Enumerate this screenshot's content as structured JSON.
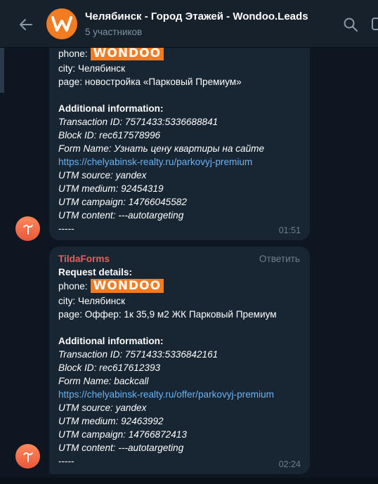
{
  "header": {
    "title": "Челябинск - Город Этажей - Wondoo.Leads",
    "subtitle": "5 участников",
    "avatar_letter": "W"
  },
  "brand_tag": "WONDOO",
  "messages": [
    {
      "phone_label": "phone:",
      "city": "city: Челябинск",
      "page": "page: новостройка «Парковый Премиум»",
      "additional_heading": "Additional information:",
      "transaction": "Transaction ID: 7571433:5336688841",
      "block": "Block ID: rec617578996",
      "form": "Form Name: Узнать цену квартиры на сайте",
      "url": "https://chelyabinsk-realty.ru/parkovyj-premium",
      "utm_source": "UTM source: yandex",
      "utm_medium": "UTM medium: 92454319",
      "utm_campaign": "UTM campaign: 14766045582",
      "utm_content": "UTM content: ---autotargeting",
      "separator": "-----",
      "time": "01:51"
    },
    {
      "sender": "TildaForms",
      "reply_label": "Ответить",
      "request_heading": "Request details:",
      "phone_label": "phone:",
      "city": "city: Челябинск",
      "page": "page: Оффер: 1к 35,9 м2 ЖК Парковый Премиум",
      "additional_heading": "Additional information:",
      "transaction": "Transaction ID: 7571433:5336842161",
      "block": "Block ID: rec617612393",
      "form": "Form Name: backcall",
      "url": "https://chelyabinsk-realty.ru/offer/parkovyj-premium",
      "utm_source": "UTM source: yandex",
      "utm_medium": "UTM medium: 92463992",
      "utm_campaign": "UTM campaign: 14766872413",
      "utm_content": "UTM content: ---autotargeting",
      "separator": "-----",
      "time": "02:24"
    }
  ],
  "icons": [
    "back-arrow-icon",
    "search-icon",
    "more-icon",
    "tilda-icon"
  ],
  "colors": {
    "background": "#0e1621",
    "header": "#17212b",
    "bubble": "#182533",
    "brand": "#f47b20",
    "link": "#6ab3f3",
    "sender": "#ef5b5b",
    "muted": "#6d7f8f"
  }
}
